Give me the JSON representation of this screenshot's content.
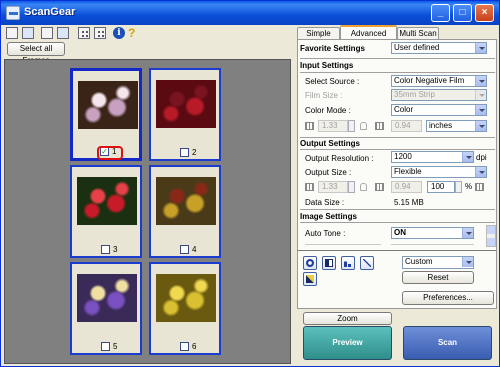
{
  "window": {
    "title": "ScanGear"
  },
  "icons": {
    "title_buttons": [
      "minimize-icon",
      "maximize-icon",
      "close-icon"
    ],
    "toolbar": [
      "rotate-left-icon",
      "rotate-right-icon",
      "zoom-icon",
      "auto-crop-icon",
      "thumbnail-grid-icon",
      "frame-grid-icon",
      "info-icon",
      "help-icon"
    ]
  },
  "toolbar": {
    "select_all_frames": "Select all Frames"
  },
  "frames": [
    {
      "number": "1",
      "checked": true,
      "colors": [
        "#3a2418",
        "#c8a0c0",
        "#f4e6ec"
      ]
    },
    {
      "number": "2",
      "checked": false,
      "colors": [
        "#5a0a10",
        "#b81a28",
        "#7a1420"
      ]
    },
    {
      "number": "3",
      "checked": false,
      "colors": [
        "#1a3010",
        "#c81a28",
        "#e84048"
      ]
    },
    {
      "number": "4",
      "checked": false,
      "colors": [
        "#4a3a18",
        "#c8a028",
        "#8a2818"
      ]
    },
    {
      "number": "5",
      "checked": false,
      "colors": [
        "#3a2a58",
        "#7a50c0",
        "#f0e0a0"
      ]
    },
    {
      "number": "6",
      "checked": false,
      "colors": [
        "#6a5a10",
        "#d8c030",
        "#f0d850"
      ]
    }
  ],
  "tabs": [
    {
      "label": "Simple Mode",
      "active": false
    },
    {
      "label": "Advanced Mode",
      "active": true
    },
    {
      "label": "Multi Scan",
      "active": false
    }
  ],
  "favorite": {
    "label": "Favorite Settings",
    "value": "User defined"
  },
  "input_settings": {
    "heading": "Input Settings",
    "select_source": {
      "label": "Select Source :",
      "value": "Color Negative Film"
    },
    "film_size": {
      "label": "Film Size :",
      "value": "35mm Strip"
    },
    "color_mode": {
      "label": "Color Mode :",
      "value": "Color"
    },
    "width": "1.33",
    "height": "0.94",
    "units": "inches"
  },
  "output_settings": {
    "heading": "Output Settings",
    "resolution": {
      "label": "Output Resolution :",
      "value": "1200",
      "unit": "dpi"
    },
    "size": {
      "label": "Output Size :",
      "value": "Flexible"
    },
    "width": "1.33",
    "height": "0.94",
    "scale": "100",
    "scale_unit": "%",
    "data_size": {
      "label": "Data Size :",
      "value": "5.15 MB"
    }
  },
  "image_settings": {
    "heading": "Image Settings",
    "auto_tone": {
      "label": "Auto Tone :",
      "value": "ON"
    }
  },
  "adjust": {
    "preset": "Custom",
    "reset": "Reset",
    "preferences": "Preferences..."
  },
  "actions": {
    "zoom": "Zoom",
    "preview": "Preview",
    "scan": "Scan"
  },
  "colors": {
    "titlebar": "#0a4fd8",
    "selected_frame": "#1428c8",
    "highlight": "#e01010",
    "preview_button": "#2e8e8a",
    "scan_button": "#3a5cb0"
  }
}
